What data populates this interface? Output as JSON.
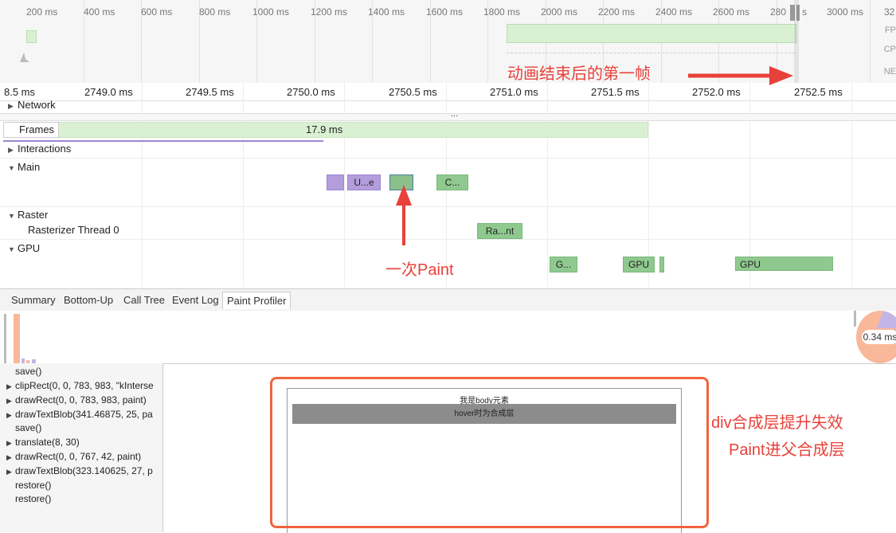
{
  "overview": {
    "ticks": [
      "200 ms",
      "400 ms",
      "600 ms",
      "800 ms",
      "1000 ms",
      "1200 ms",
      "1400 ms",
      "1600 ms",
      "1800 ms",
      "2000 ms",
      "2200 ms",
      "2400 ms",
      "2600 ms",
      "280",
      "s",
      "3000 ms",
      "32"
    ],
    "lanes": [
      "FP",
      "CP",
      "NE"
    ]
  },
  "ruler": {
    "ticks": [
      "8.5 ms",
      "2749.0 ms",
      "2749.5 ms",
      "2750.0 ms",
      "2750.5 ms",
      "2751.0 ms",
      "2751.5 ms",
      "2752.0 ms",
      "2752.5 ms"
    ]
  },
  "tracks": {
    "network": "Network",
    "frames": "Frames",
    "frame_duration": "17.9 ms",
    "ellipsis": "...",
    "interactions": "Interactions",
    "main": "Main",
    "raster": "Raster",
    "rasterizer": "Rasterizer Thread 0",
    "gpu": "GPU"
  },
  "blocks": {
    "main_u": "U...e",
    "main_c": "C...",
    "raster_ra": "Ra...nt",
    "gpu_g": "G...",
    "gpu_1": "GPU",
    "gpu_2": "GPU"
  },
  "tabs": [
    "Summary",
    "Bottom-Up",
    "Call Tree",
    "Event Log",
    "Paint Profiler"
  ],
  "active_tab": "Paint Profiler",
  "profiler": {
    "time_label": "0.34 ms"
  },
  "commands": [
    {
      "text": "save()",
      "arrow": false
    },
    {
      "text": "clipRect(0, 0, 783, 983, \"kInterse",
      "arrow": true
    },
    {
      "text": "drawRect(0, 0, 783, 983, paint)",
      "arrow": true
    },
    {
      "text": "drawTextBlob(341.46875, 25, pa",
      "arrow": true
    },
    {
      "text": "save()",
      "arrow": false
    },
    {
      "text": "translate(8, 30)",
      "arrow": true
    },
    {
      "text": "drawRect(0, 0, 767, 42, paint)",
      "arrow": true
    },
    {
      "text": "drawTextBlob(323.140625, 27, p",
      "arrow": true
    },
    {
      "text": "restore()",
      "arrow": false
    },
    {
      "text": "restore()",
      "arrow": false
    }
  ],
  "preview": {
    "body_text": "我是body元素",
    "hover_text": "hover时为合成层"
  },
  "annotations": {
    "first_frame": "动画结束后的第一帧",
    "one_paint": "一次Paint",
    "div_fail": "div合成层提升失效",
    "paint_into": "Paint进父合成层"
  },
  "colors": {
    "annotation": "#e8413a",
    "frame_green": "#d9f0d3",
    "task_purple": "#b39ddb",
    "task_green": "#8fc98f",
    "highlight_box": "#f0643c"
  }
}
